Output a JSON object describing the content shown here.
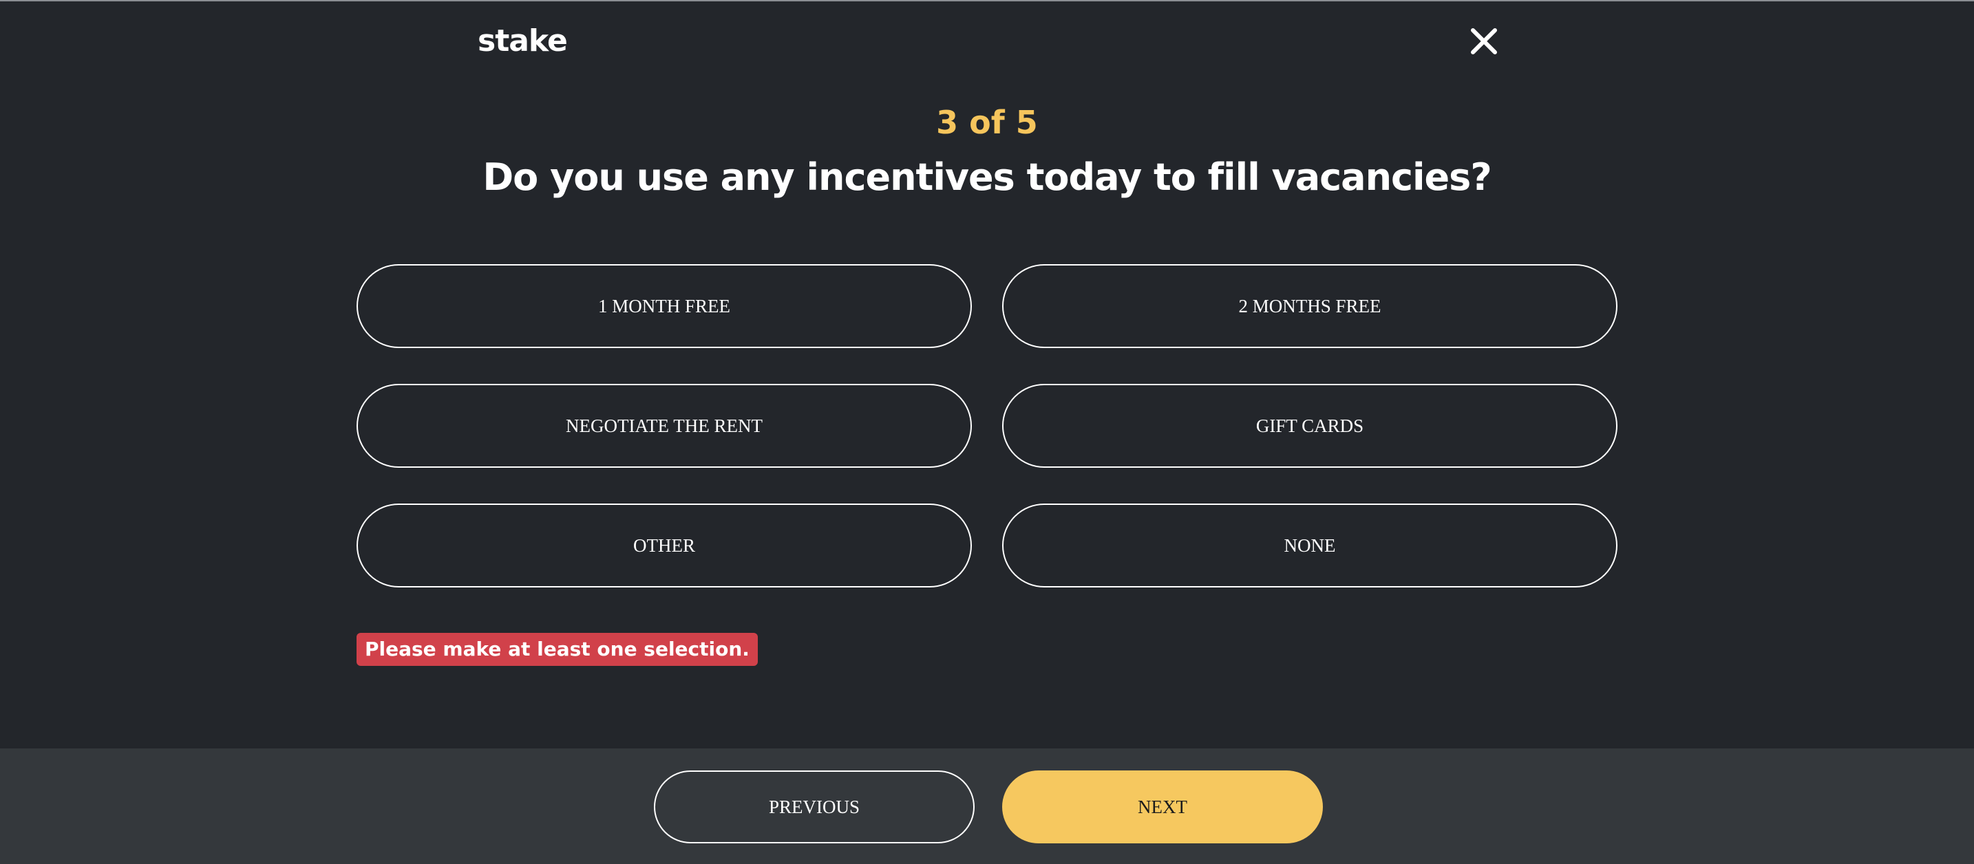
{
  "header": {
    "logo_text": "stake",
    "close_icon": "close-icon"
  },
  "survey": {
    "step_text": "3 of 5",
    "question": "Do you use any incentives today to fill vacancies?",
    "options": [
      {
        "label": "1 MONTH FREE"
      },
      {
        "label": "2 MONTHS FREE"
      },
      {
        "label": "NEGOTIATE THE RENT"
      },
      {
        "label": "GIFT CARDS"
      },
      {
        "label": "OTHER"
      },
      {
        "label": "NONE"
      }
    ],
    "error_text": "Please make at least one selection."
  },
  "footer": {
    "previous_label": "PREVIOUS",
    "next_label": "NEXT"
  },
  "colors": {
    "background": "#23262b",
    "footer_background": "#34383c",
    "accent": "#f6c85f",
    "error": "#d1414a"
  }
}
